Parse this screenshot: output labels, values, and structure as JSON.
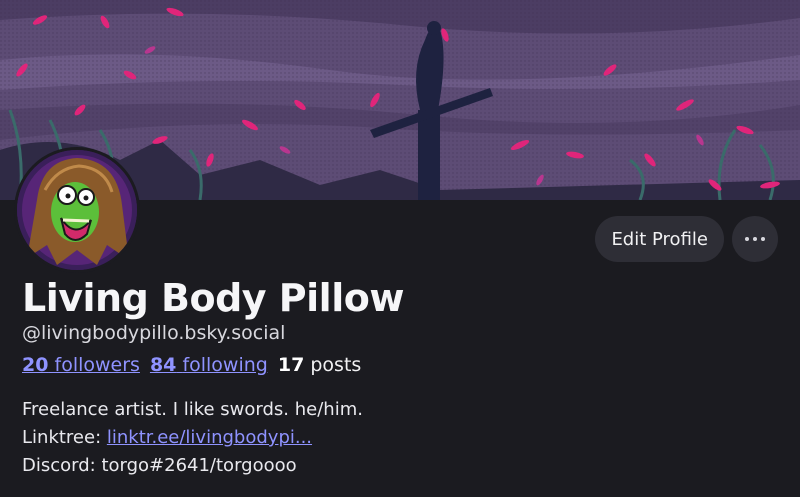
{
  "profile": {
    "display_name": "Living Body Pillow",
    "handle": "@livingbodypillo.bsky.social",
    "followers_count": "20",
    "followers_label": "followers",
    "following_count": "84",
    "following_label": "following",
    "posts_count": "17",
    "posts_label": "posts"
  },
  "actions": {
    "edit_label": "Edit Profile",
    "more_icon": "more-horizontal-icon"
  },
  "bio": {
    "line1": "Freelance artist. I like swords. he/him.",
    "linktree_prefix": "Linktree: ",
    "linktree_link": "linktr.ee/livingbodypi...",
    "line3": "Discord: torgo#2641/torgoooo"
  },
  "colors": {
    "background": "#1b1b20",
    "link": "#8f93ff",
    "button": "#2e2e36",
    "banner_sky": "#5b4a73",
    "petals": "#e0257a"
  }
}
